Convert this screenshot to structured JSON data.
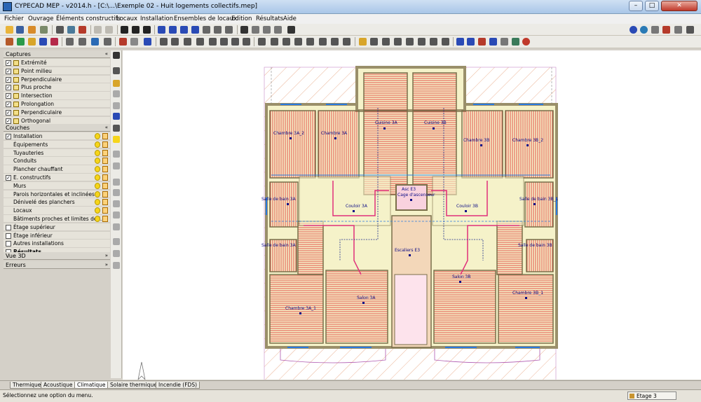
{
  "window": {
    "title": "CYPECAD MEP - v2014.h - [C:\\...\\Exemple 02 - Huit logements collectifs.mep]"
  },
  "menu": [
    "Fichier",
    "Ouvrage",
    "Éléments constructifs",
    "Locaux",
    "Installation",
    "Ensembles de locaux",
    "Edition",
    "Résultats",
    "Aide"
  ],
  "panels": {
    "captures": {
      "title": "Captures",
      "items": [
        {
          "label": "Extrémité",
          "checked": true,
          "icon": "square-snap-icon"
        },
        {
          "label": "Point milieu",
          "checked": true,
          "icon": "triangle-snap-icon"
        },
        {
          "label": "Perpendiculaire",
          "checked": true,
          "icon": "perpendicular-snap-icon"
        },
        {
          "label": "Plus proche",
          "checked": true,
          "icon": "hourglass-snap-icon"
        },
        {
          "label": "Intersection",
          "checked": true,
          "icon": "x-snap-icon"
        },
        {
          "label": "Prolongation",
          "checked": true,
          "icon": "plus-snap-icon"
        },
        {
          "label": "Perpendiculaire",
          "checked": true,
          "icon": "plus-snap-icon"
        },
        {
          "label": "Orthogonal",
          "checked": true,
          "icon": "plus-snap-icon"
        }
      ]
    },
    "couches": {
      "title": "Couches",
      "items": [
        {
          "label": "Installation",
          "checked": true,
          "indent": 0
        },
        {
          "label": "Équipements",
          "indent": 1
        },
        {
          "label": "Tuyauteries",
          "indent": 1
        },
        {
          "label": "Conduits",
          "indent": 1
        },
        {
          "label": "Plancher chauffant",
          "indent": 1
        },
        {
          "label": "E. constructifs",
          "checked": true,
          "indent": 0
        },
        {
          "label": "Murs",
          "indent": 1
        },
        {
          "label": "Parois horizontales et inclinées",
          "indent": 1
        },
        {
          "label": "Dénivelé des planchers",
          "indent": 1
        },
        {
          "label": "Locaux",
          "indent": 1
        },
        {
          "label": "Bâtiments proches et limites de l...",
          "indent": 1
        },
        {
          "label": "Étage supérieur",
          "checked": false,
          "indent": 0
        },
        {
          "label": "Étage inférieur",
          "checked": false,
          "indent": 0
        },
        {
          "label": "Autres installations",
          "checked": false,
          "indent": 0
        },
        {
          "label": "Résultats",
          "checked": false,
          "indent": 0,
          "bold": true
        }
      ]
    },
    "vue3d": {
      "title": "Vue 3D"
    },
    "erreurs": {
      "title": "Erreurs"
    }
  },
  "plan_labels": {
    "chambre_3a_2": "Chambre 3A_2",
    "chambre_3a": "Chambre 3A",
    "cuisine_3a": "Cuisine 3A",
    "cuisine_3b": "Cuisine 3B",
    "chambre_3b": "Chambre 3B",
    "chambre_3b_2": "Chambre 3B_2",
    "asc_e3": "Asc E3",
    "cage_ascenseur": "Cage d'ascenseur",
    "salle_bain_3a": "Salle de bain 3A",
    "couloir_3a": "Couloir 3A",
    "couloir_3b": "Couloir 3B",
    "salle_bain_3b_1": "Salle de bain 3B_1",
    "salle_bain_3a_1": "Salle de bain 3A",
    "salle_bain_3b": "Salle de bain 3B",
    "escaliers_e3": "Escaliers E3",
    "chambre_3a_1": "Chambre 3A_1",
    "salon_3a": "Salon 3A",
    "salon_3b": "Salon 3B",
    "chambre_3b_1": "Chambre 3B_1"
  },
  "tabs": [
    "Thermique",
    "Acoustique",
    "Climatique",
    "Solaire thermique",
    "Incendie (FDS)"
  ],
  "active_tab": "Climatique",
  "status": {
    "message": "Sélectionnez une option du menu.",
    "level": "Etage 3"
  }
}
